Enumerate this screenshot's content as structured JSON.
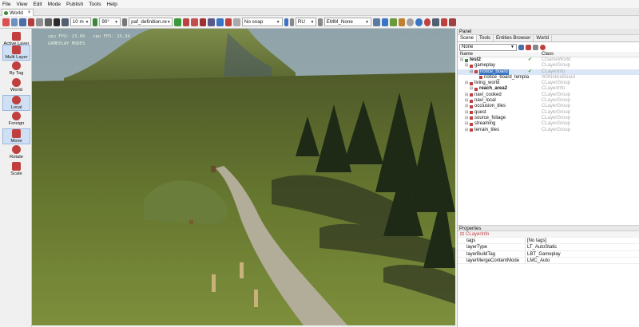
{
  "menu": [
    "File",
    "View",
    "Edit",
    "Mode",
    "Publish",
    "Tools",
    "Help"
  ],
  "doc_tab": {
    "label": "World",
    "close": "×"
  },
  "toolbar": {
    "distance": "10 m",
    "angle": "90°",
    "definition": "paf_definition.re",
    "snap": "No snap",
    "region": "RU",
    "emm": "EMM_None"
  },
  "left_panel": {
    "active_layer": "Active Layer",
    "multi_layer": "Multi Layer",
    "by_tag": "By Tag",
    "world": "World",
    "local": "Local",
    "foreign": "Foreign",
    "move": "Move",
    "rotate": "Rotate",
    "scale": "Scale"
  },
  "viewport": {
    "overlay_line1_a": "cpu FPS: 23.09",
    "overlay_line1_b": "cpu FPS: 23.34",
    "overlay_line2": "GAMEPLAY MODES"
  },
  "panel": {
    "title": "Panel",
    "tabs": [
      "Scene",
      "Tools",
      "Entities Browser",
      "World"
    ],
    "filter": "None",
    "col_name": "Name",
    "col_class": "Class",
    "tree": [
      {
        "label": "test2",
        "cls": "CGameWorld",
        "level": 0,
        "color": "#3a8a3a",
        "bold": true,
        "check": "✔"
      },
      {
        "label": "gameplay",
        "cls": "CLayerGroup",
        "level": 1,
        "color": "#c04040",
        "bold": false,
        "check": ""
      },
      {
        "label": "notice_board",
        "cls": "CLayerInfo",
        "level": 2,
        "color": "#c04040",
        "bold": false,
        "check": "✔",
        "selected": true
      },
      {
        "label": "notice_board_templa",
        "cls": "W3NoticeBoard",
        "level": 3,
        "color": "#c04040",
        "bold": false,
        "check": ""
      },
      {
        "label": "living_world",
        "cls": "CLayerGroup",
        "level": 1,
        "color": "#c04040",
        "bold": false,
        "check": ""
      },
      {
        "label": "reach_area2",
        "cls": "CLayerInfo",
        "level": 2,
        "color": "#c04040",
        "bold": true,
        "check": ""
      },
      {
        "label": "navi_cooked",
        "cls": "CLayerGroup",
        "level": 1,
        "color": "#c04040",
        "bold": false,
        "check": ""
      },
      {
        "label": "navi_local",
        "cls": "CLayerGroup",
        "level": 1,
        "color": "#c04040",
        "bold": false,
        "check": ""
      },
      {
        "label": "occlusion_tiles",
        "cls": "CLayerGroup",
        "level": 1,
        "color": "#c04040",
        "bold": false,
        "check": ""
      },
      {
        "label": "quest",
        "cls": "CLayerGroup",
        "level": 1,
        "color": "#c04040",
        "bold": false,
        "check": ""
      },
      {
        "label": "source_foliage",
        "cls": "CLayerGroup",
        "level": 1,
        "color": "#c04040",
        "bold": false,
        "check": ""
      },
      {
        "label": "streaming",
        "cls": "CLayerGroup",
        "level": 1,
        "color": "#c04040",
        "bold": false,
        "check": ""
      },
      {
        "label": "terrain_tiles",
        "cls": "CLayerGroup",
        "level": 1,
        "color": "#c04040",
        "bold": false,
        "check": ""
      }
    ]
  },
  "properties": {
    "title": "Properties",
    "object": "CLayerInfo",
    "rows": [
      {
        "key": "tags",
        "value": "[No tags]"
      },
      {
        "key": "layerType",
        "value": "LT_AutoStatic"
      },
      {
        "key": "layerBuildTag",
        "value": "LBT_Gameplay"
      },
      {
        "key": "layerMergeContentMode",
        "value": "LMC_Auto"
      }
    ]
  },
  "colors": {
    "accent": "#3a74c4",
    "terrain": "#6b7a3a",
    "sky": "#93a6ad"
  }
}
